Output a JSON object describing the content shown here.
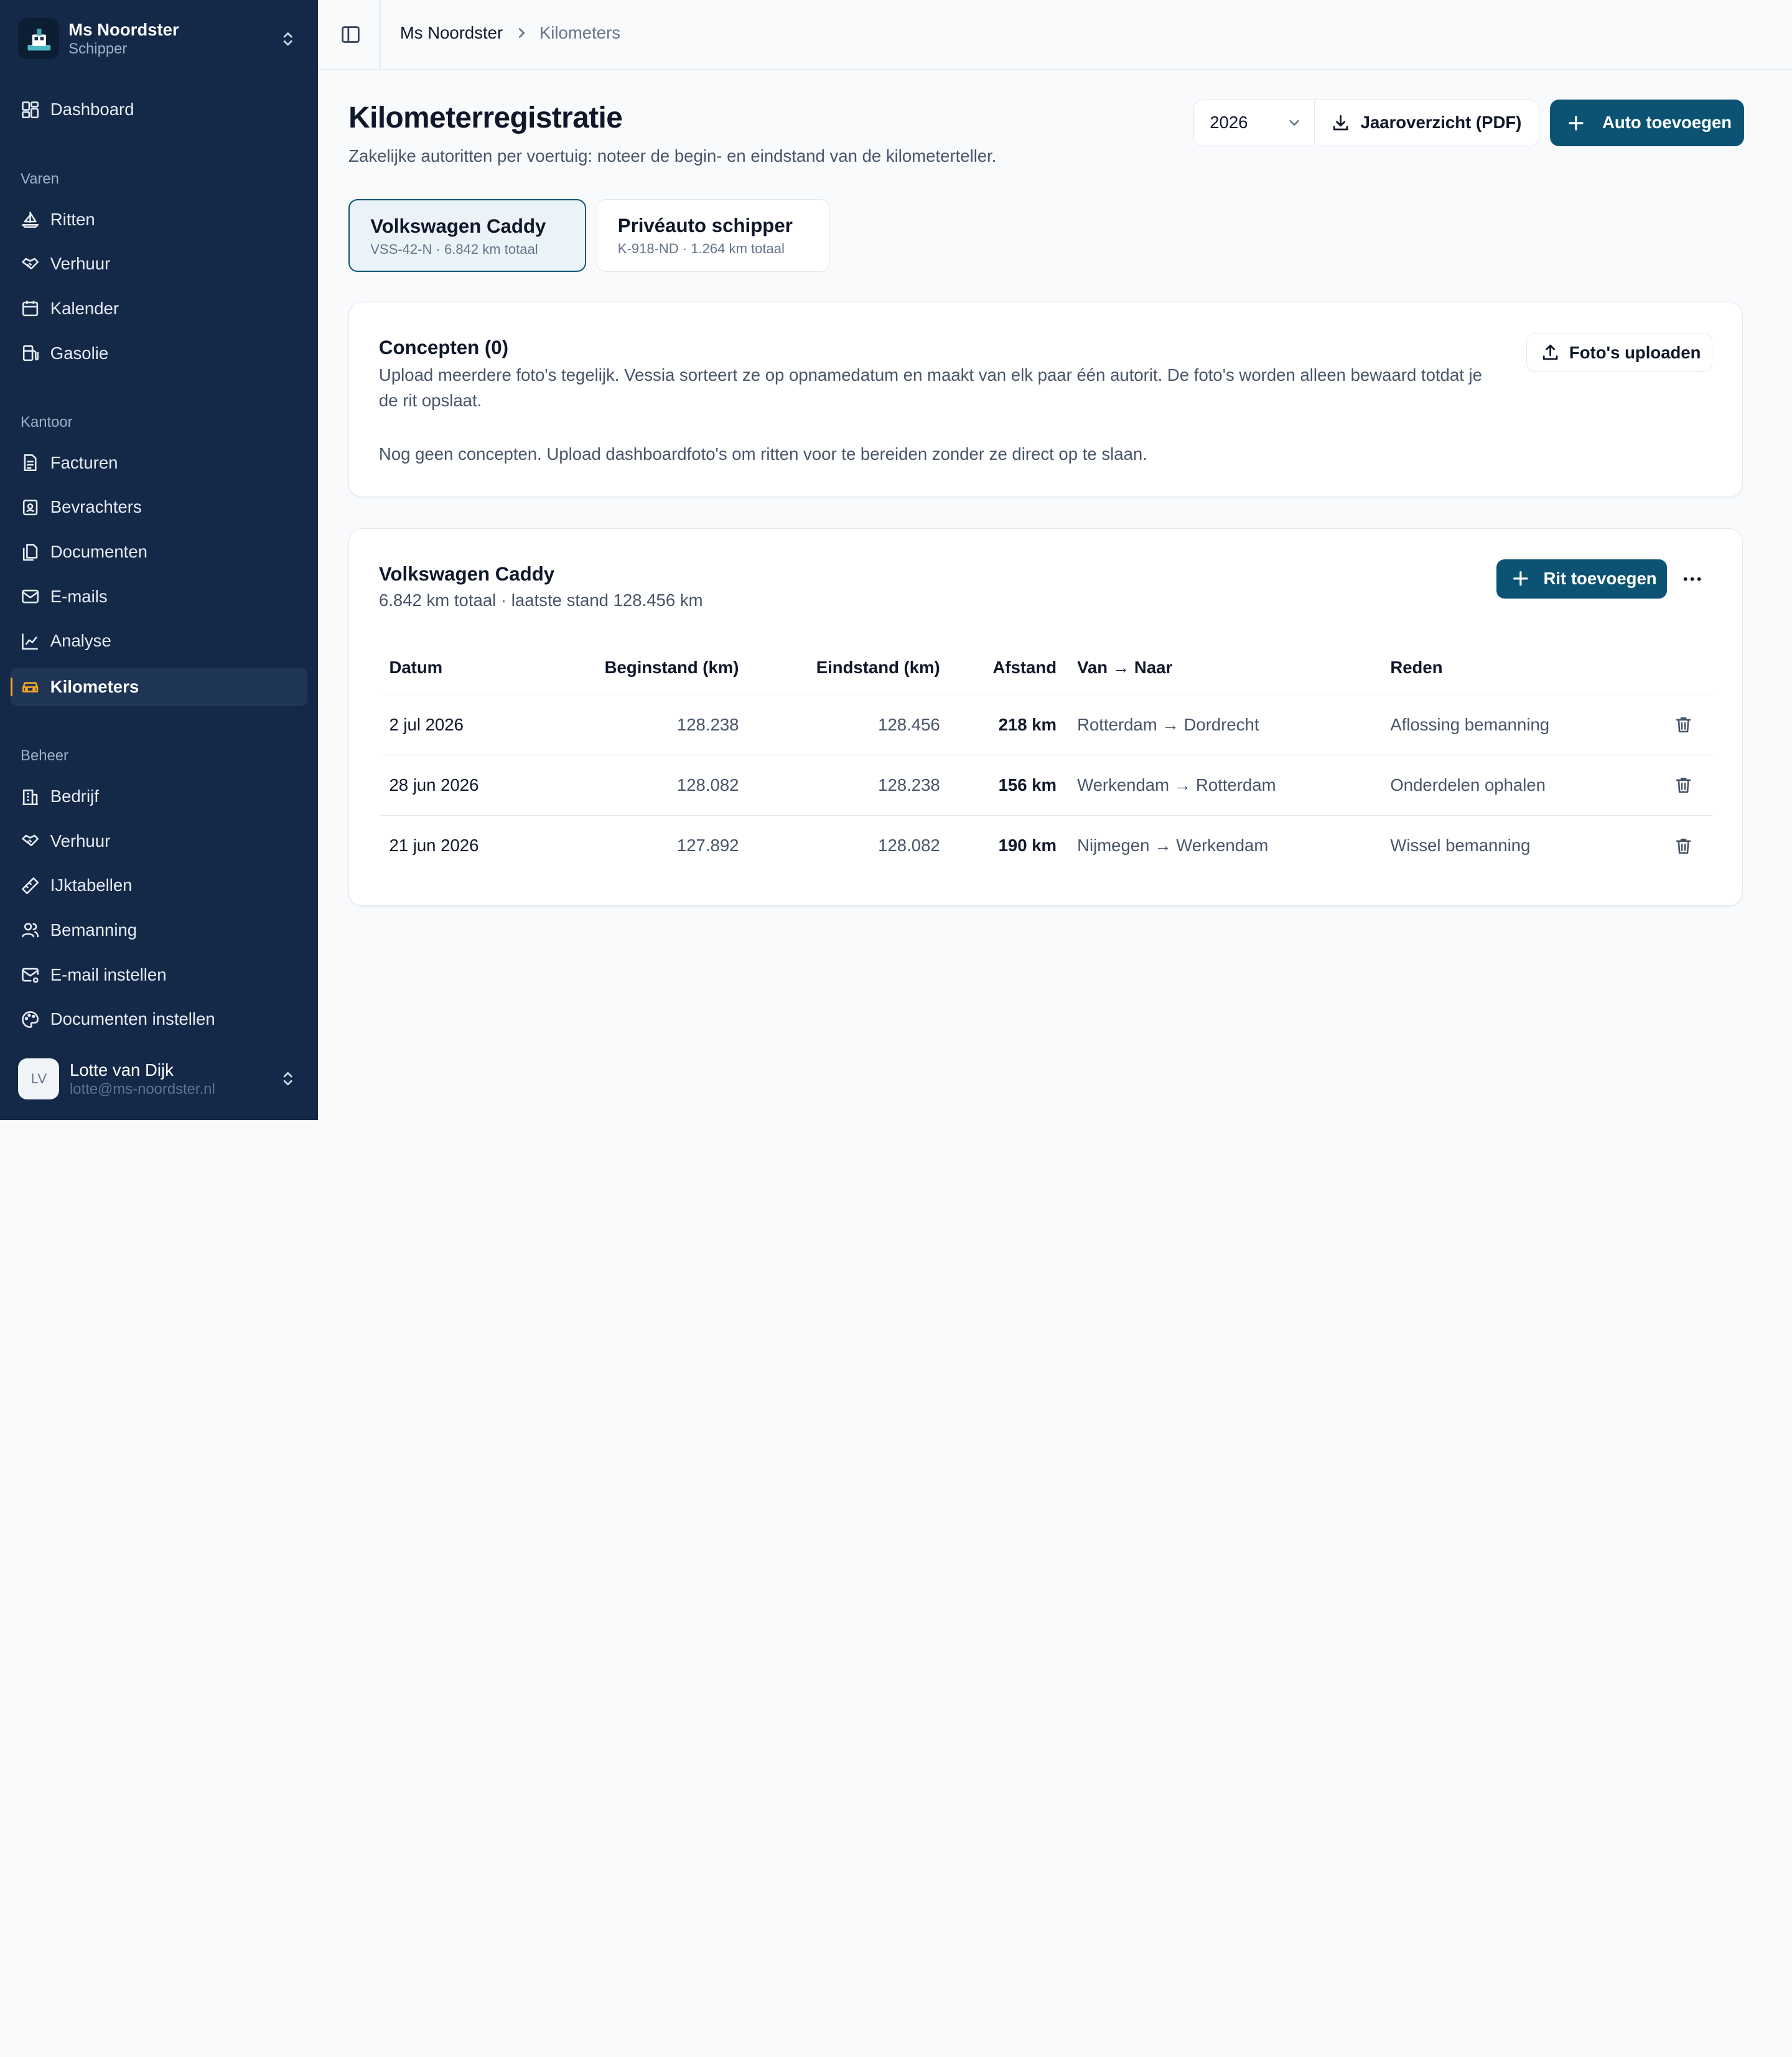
{
  "org": {
    "name": "Ms Noordster",
    "role": "Schipper"
  },
  "nav": {
    "dashboard": "Dashboard",
    "sec_varen": "Varen",
    "ritten": "Ritten",
    "verhuur": "Verhuur",
    "kalender": "Kalender",
    "gasolie": "Gasolie",
    "sec_kantoor": "Kantoor",
    "facturen": "Facturen",
    "bevrachters": "Bevrachters",
    "documenten": "Documenten",
    "emails": "E-mails",
    "analyse": "Analyse",
    "kilometers": "Kilometers",
    "sec_beheer": "Beheer",
    "bedrijf": "Bedrijf",
    "verhuur2": "Verhuur",
    "ijktabellen": "IJktabellen",
    "bemanning": "Bemanning",
    "email_instellen": "E-mail instellen",
    "documenten_instellen": "Documenten instellen"
  },
  "user": {
    "initials": "LV",
    "name": "Lotte van Dijk",
    "email": "lotte@ms-noordster.nl"
  },
  "breadcrumb": {
    "root": "Ms Noordster",
    "current": "Kilometers"
  },
  "page": {
    "title": "Kilometerregistratie",
    "subtitle": "Zakelijke autoritten per voertuig: noteer de begin- en eindstand van de kilometerteller.",
    "year": "2026",
    "pdf_label": "Jaaroverzicht (PDF)",
    "add_car_label": "Auto toevoegen"
  },
  "vehicles": [
    {
      "name": "Volkswagen Caddy",
      "meta": "VSS-42-N · 6.842 km totaal"
    },
    {
      "name": "Privéauto schipper",
      "meta": "K-918-ND · 1.264 km totaal"
    }
  ],
  "concepts": {
    "title": "Concepten (0)",
    "description": "Upload meerdere foto's tegelijk. Vessia sorteert ze op opnamedatum en maakt van elk paar één autorit. De foto's worden alleen bewaard totdat je de rit opslaat.",
    "empty": "Nog geen concepten. Upload dashboardfoto's om ritten voor te bereiden zonder ze direct op te slaan.",
    "upload_label": "Foto's uploaden"
  },
  "trips": {
    "title": "Volkswagen Caddy",
    "subtitle": "6.842 km totaal · laatste stand 128.456 km",
    "add_label": "Rit toevoegen",
    "headers": {
      "datum": "Datum",
      "begin": "Beginstand (km)",
      "eind": "Eindstand (km)",
      "afstand": "Afstand",
      "route": "Van → Naar",
      "reden": "Reden"
    },
    "rows": [
      {
        "datum": "2 jul 2026",
        "begin": "128.238",
        "eind": "128.456",
        "afstand": "218 km",
        "route": "Rotterdam → Dordrecht",
        "reden": "Aflossing bemanning"
      },
      {
        "datum": "28 jun 2026",
        "begin": "128.082",
        "eind": "128.238",
        "afstand": "156 km",
        "route": "Werkendam → Rotterdam",
        "reden": "Onderdelen ophalen"
      },
      {
        "datum": "21 jun 2026",
        "begin": "127.892",
        "eind": "128.082",
        "afstand": "190 km",
        "route": "Nijmegen → Werkendam",
        "reden": "Wissel bemanning"
      }
    ]
  },
  "colors": {
    "sidebar": "#142847",
    "primary": "#0c5373",
    "active_marker": "#f5a623"
  }
}
